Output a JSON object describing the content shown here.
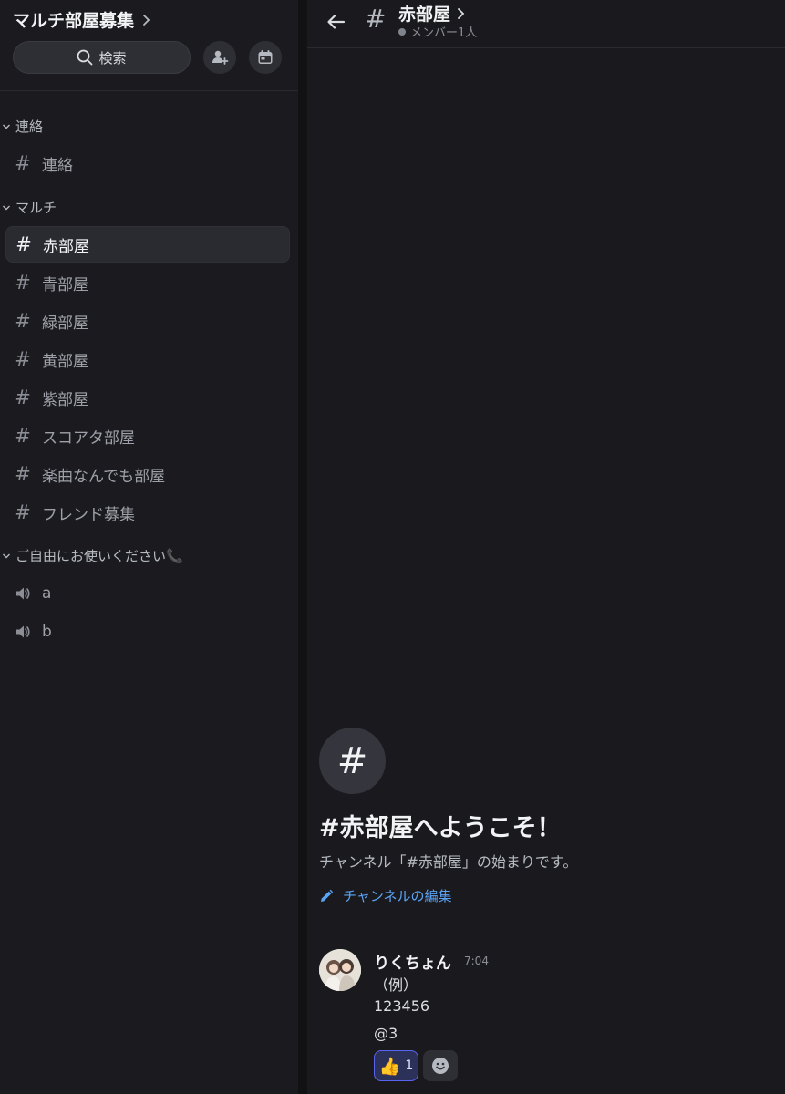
{
  "server": {
    "name": "マルチ部屋募集"
  },
  "search": {
    "label": "検索"
  },
  "categories": [
    {
      "name": "連絡",
      "channels": [
        "連絡"
      ]
    },
    {
      "name": "マルチ",
      "channels": [
        "赤部屋",
        "青部屋",
        "緑部屋",
        "黄部屋",
        "紫部屋",
        "スコアタ部屋",
        "楽曲なんでも部屋",
        "フレンド募集"
      ]
    },
    {
      "name": "ご自由にお使いください📞",
      "voice_channels": [
        "a",
        "b"
      ]
    }
  ],
  "active_channel": "赤部屋",
  "header": {
    "hash": "#",
    "channel_name": "赤部屋",
    "member_status": "メンバー1人"
  },
  "welcome": {
    "hash_glyph": "#",
    "title": "#赤部屋へようこそ！",
    "subtitle": "チャンネル「#赤部屋」の始まりです。",
    "edit_label": "チャンネルの編集"
  },
  "message": {
    "author": "りくちょん",
    "time": "7:04",
    "lines": [
      "（例）",
      "123456",
      "@3"
    ],
    "reaction": {
      "emoji": "👍",
      "count": "1"
    }
  },
  "icons": {
    "search": "search-icon",
    "add_member": "add-member-icon",
    "event": "calendar-icon",
    "back": "arrow-left-icon",
    "voice": "speaker-icon",
    "edit": "pencil-icon",
    "add_reaction": "smiley-icon"
  },
  "colors": {
    "accent_link": "#5ba4f5",
    "reaction_border": "#5865f2",
    "background": "#1a1a1e"
  }
}
